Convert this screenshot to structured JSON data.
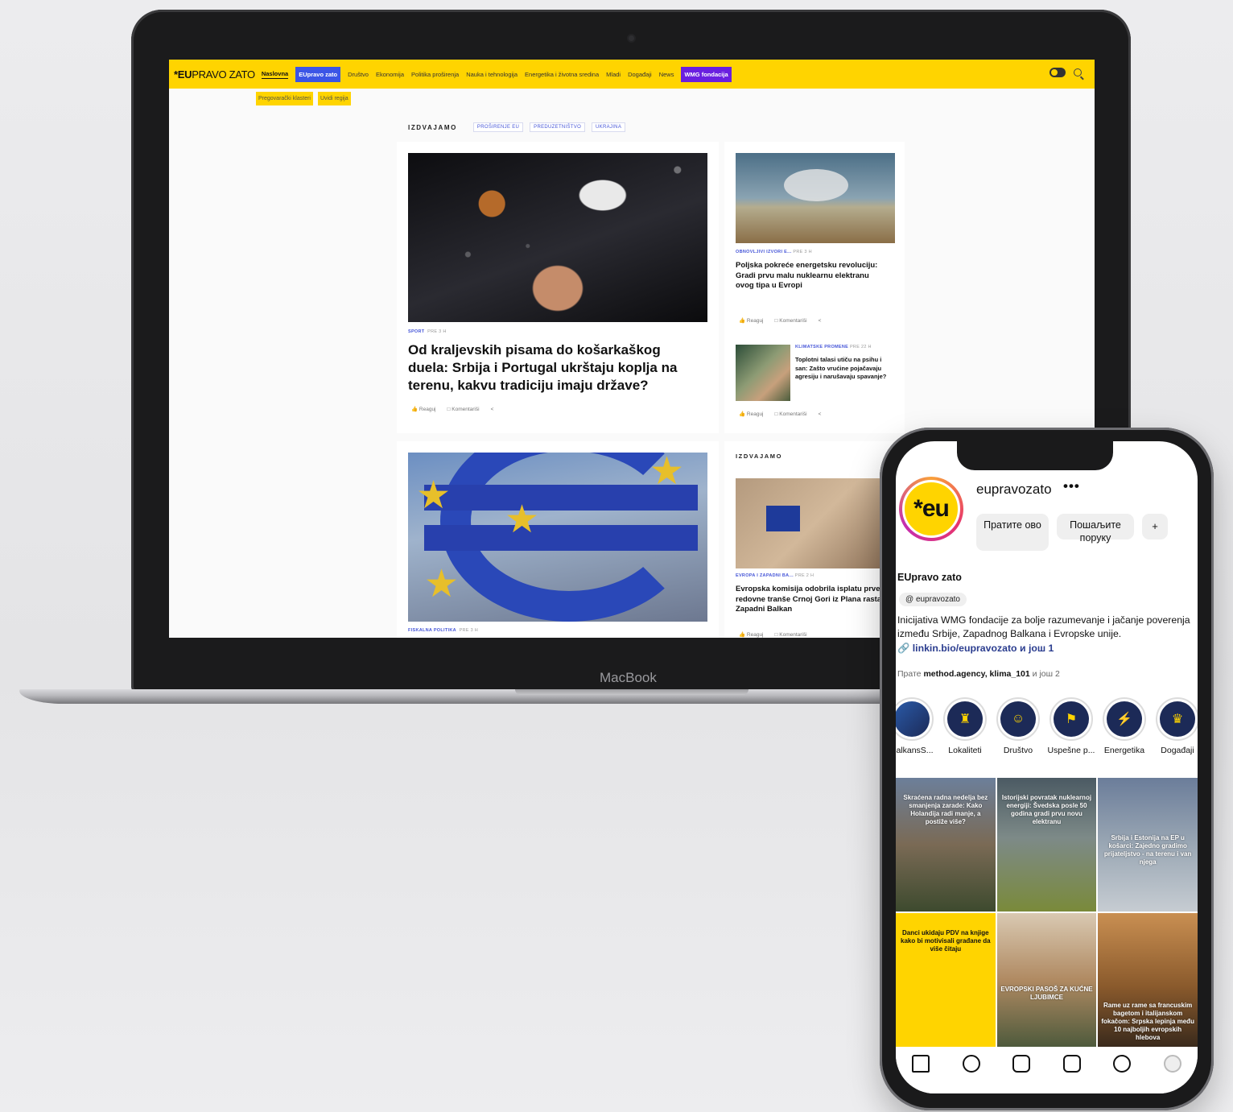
{
  "laptop": {
    "bezel_label": "MacBook",
    "site": {
      "logo_bold": "*EU",
      "logo_thin": "PRAVO ZATO",
      "nav_items": [
        {
          "label": "Naslovna",
          "style": "active"
        },
        {
          "label": "EUpravo zato",
          "style": "blue"
        },
        {
          "label": "Društvo",
          "style": "normal"
        },
        {
          "label": "Ekonomija",
          "style": "normal"
        },
        {
          "label": "Politika proširenja",
          "style": "normal"
        },
        {
          "label": "Nauka i tehnologija",
          "style": "normal"
        },
        {
          "label": "Energetika i životna sredina",
          "style": "normal"
        },
        {
          "label": "Mladi",
          "style": "normal"
        },
        {
          "label": "Događaji",
          "style": "normal"
        },
        {
          "label": "News",
          "style": "normal"
        },
        {
          "label": "WMG fondacija",
          "style": "purple"
        }
      ],
      "subnav": [
        "Pregovarački klasteri",
        "Uvidi regija"
      ],
      "izdvajamo": {
        "title": "IZDVAJAMO",
        "chips": [
          "PROŠIRENJE EU",
          "PREDUZETNIŠTVO",
          "UKRAJINA"
        ]
      },
      "main_article": {
        "category": "SPORT",
        "time": "PRE 3 H",
        "title": "Od kraljevskih pisama do košarkaškog duela: Srbija i Portugal ukrštaju koplja na terenu, kakvu tradiciju imaju države?",
        "react": "Reaguj",
        "comments": "Komentariši"
      },
      "side_article_1": {
        "category": "OBNOVLJIVI IZVORI E...",
        "time": "PRE 3 H",
        "title": "Poljska pokreće energetsku revoluciju: Gradi prvu malu nuklearnu elektranu ovog tipa u Evropi",
        "react": "Reaguj",
        "comments": "Komentariši"
      },
      "side_article_2": {
        "category": "KLIMATSKE PROMENE",
        "time": "PRE 22 H",
        "title": "Toplotni talasi utiču na psihu i san: Zašto vrućine pojačavaju agresiju i narušavaju spavanje?",
        "react": "Reaguj",
        "comments": "Komentariši"
      },
      "second_row": {
        "main_category": "FISKALNA POLITIKA",
        "main_time": "PRE 3 H",
        "side_header": "IZDVAJAMO",
        "side_category": "EVROPA I ZAPADNI BA...",
        "side_time": "PRE 2 H",
        "side_title": "Evropska komisija odobrila isplatu prve redovne tranše Crnoj Gori iz Plana rasta za Zapadni Balkan",
        "side_react": "Reaguj",
        "side_comments": "Komentariši"
      }
    }
  },
  "phone": {
    "username": "eupravozato",
    "more": "•••",
    "avatar_text": "*eu",
    "follow_button": "Пратите ово",
    "message_button": "Пошаљите поруку",
    "add_person": "+",
    "display_name": "EUpravo zato",
    "threads_handle": "eupravozato",
    "bio": "Inicijativa WMG fondacije za bolje razumevanje i jačanje poverenja između Srbije, Zapadnog Balkana i Evropske unije.",
    "link": "linkin.bio/eupravozato и још 1",
    "followed_prefix": "Прате",
    "followed_names": "method.agency, klima_101",
    "followed_suffix": "и још 2",
    "highlights": [
      "BalkansS...",
      "Lokaliteti",
      "Društvo",
      "Uspešne p...",
      "Energetika",
      "Događaji"
    ],
    "posts": [
      {
        "text": "Skraćena radna nedelja bez smanjenja zarade: Kako Holandija radi manje, a postiže više?"
      },
      {
        "text": "Istorijski povratak nuklearnoj energiji: Švedska posle 50 godina gradi prvu novu elektranu"
      },
      {
        "text": "Srbija i Estonija na EP u košarci: Zajedno gradimo prijateljstvo - na terenu i van njega"
      },
      {
        "text": "Danci ukidaju PDV na knjige kako bi motivisali građane da više čitaju"
      },
      {
        "text": "EVROPSKI PASOŠ ZA KUĆNE LJUBIMCE"
      },
      {
        "text": "Rame uz rame sa francuskim bagetom i italijanskom fokačom: Srpska lepinja među 10 najboljih evropskih hlebova"
      }
    ]
  }
}
